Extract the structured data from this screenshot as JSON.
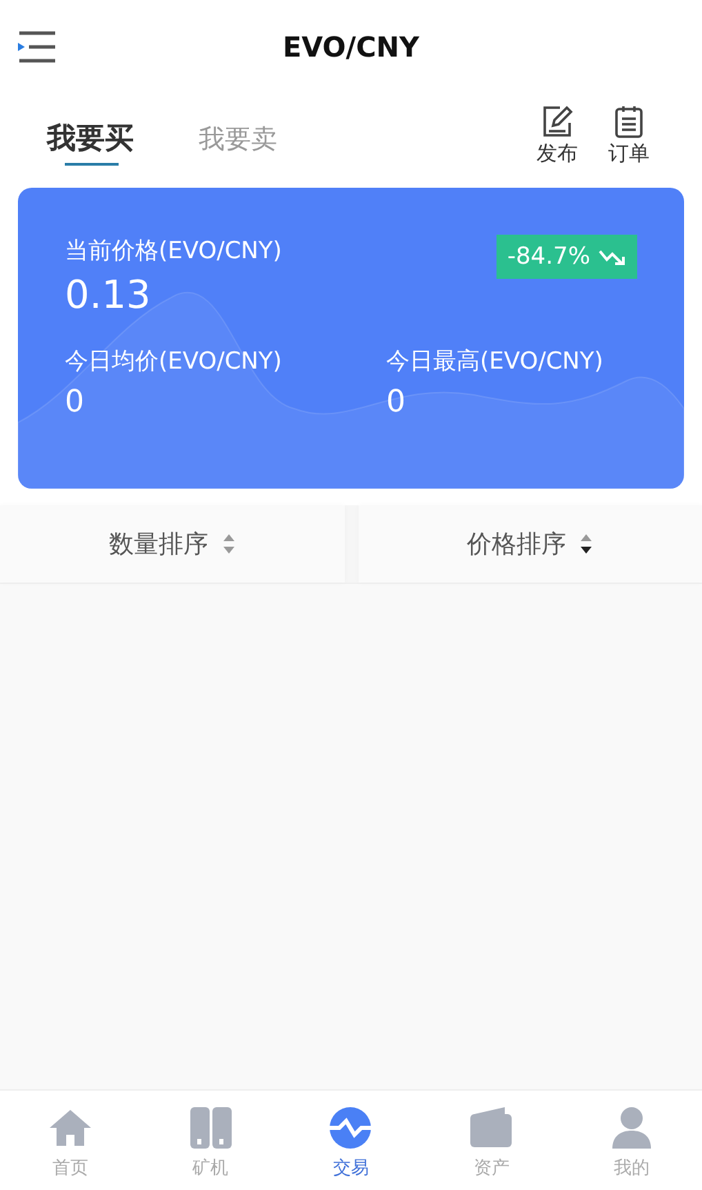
{
  "header": {
    "title": "EVO/CNY"
  },
  "tabs": [
    {
      "label": "我要买",
      "selected": true
    },
    {
      "label": "我要卖",
      "selected": false
    }
  ],
  "actions": [
    {
      "kind": "publish",
      "label": "发布"
    },
    {
      "kind": "orders",
      "label": "订单"
    }
  ],
  "price_card": {
    "label": "当前价格(EVO/CNY)",
    "price": "0.13",
    "change": "-84.7%",
    "falling": true,
    "stats": [
      {
        "label": "今日均价(EVO/CNY)",
        "value": "0"
      },
      {
        "label": "今日最高(EVO/CNY)",
        "value": "0"
      }
    ]
  },
  "sort": [
    {
      "label": "数量排序",
      "selected": false
    },
    {
      "label": "价格排序",
      "selected": true
    }
  ],
  "nav": [
    {
      "kind": "home",
      "label": "首页",
      "selected": false
    },
    {
      "kind": "miner",
      "label": "矿机",
      "selected": false
    },
    {
      "kind": "trade",
      "label": "交易",
      "selected": true
    },
    {
      "kind": "assets",
      "label": "资产",
      "selected": false
    },
    {
      "kind": "me",
      "label": "我的",
      "selected": false
    }
  ]
}
